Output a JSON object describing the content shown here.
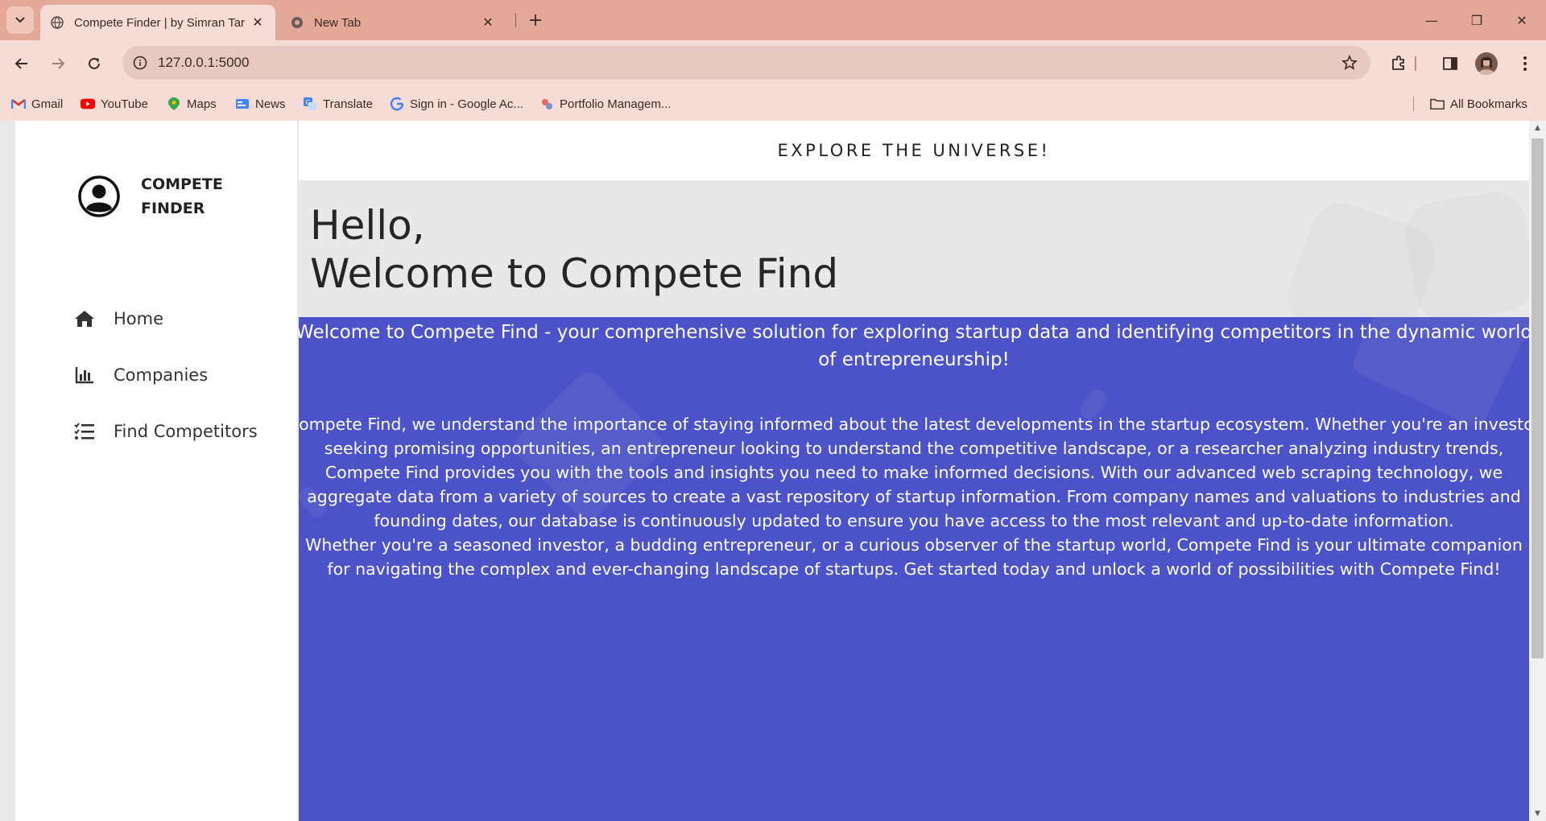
{
  "browser": {
    "tabs": [
      {
        "title": "Compete Finder | by Simran Tar",
        "active": true
      },
      {
        "title": "New Tab",
        "active": false
      }
    ],
    "url": "127.0.0.1:5000",
    "bookmarks": [
      {
        "label": "Gmail",
        "icon": "gmail-icon"
      },
      {
        "label": "YouTube",
        "icon": "youtube-icon"
      },
      {
        "label": "Maps",
        "icon": "maps-icon"
      },
      {
        "label": "News",
        "icon": "news-icon"
      },
      {
        "label": "Translate",
        "icon": "translate-icon"
      },
      {
        "label": "Sign in - Google Ac...",
        "icon": "google-icon"
      },
      {
        "label": "Portfolio Managem...",
        "icon": "portfolio-icon"
      }
    ],
    "all_bookmarks": "All Bookmarks"
  },
  "sidebar": {
    "brand": "COMPETE FINDER",
    "items": [
      {
        "label": "Home",
        "icon": "home-icon"
      },
      {
        "label": "Companies",
        "icon": "bar-chart-icon"
      },
      {
        "label": "Find Competitors",
        "icon": "list-check-icon"
      }
    ]
  },
  "main": {
    "banner": "EXPLORE THE UNIVERSE!",
    "greeting_line1": "Hello,",
    "greeting_line2": "Welcome to Compete Find",
    "intro": "Welcome to Compete Find - your comprehensive solution for exploring startup data and identifying competitors in the dynamic world of entrepreneurship!",
    "paragraph1": "Compete Find, we understand the importance of staying informed about the latest developments in the startup ecosystem. Whether you're an investor seeking promising opportunities, an entrepreneur looking to understand the competitive landscape, or a researcher analyzing industry trends, Compete Find provides you with the tools and insights you need to make informed decisions. With our advanced web scraping technology, we aggregate data from a variety of sources to create a vast repository of startup information. From company names and valuations to industries and founding dates, our database is continuously updated to ensure you have access to the most relevant and up-to-date information.",
    "paragraph2": "Whether you're a seasoned investor, a budding entrepreneur, or a curious observer of the startup world, Compete Find is your ultimate companion for navigating the complex and ever-changing landscape of startups. Get started today and unlock a world of possibilities with Compete Find!"
  },
  "colors": {
    "tabbar": "#e4a899",
    "toolbar": "#f6dcd5",
    "content_bg": "#4c53c8",
    "hero_bg": "#e8e8e8"
  }
}
